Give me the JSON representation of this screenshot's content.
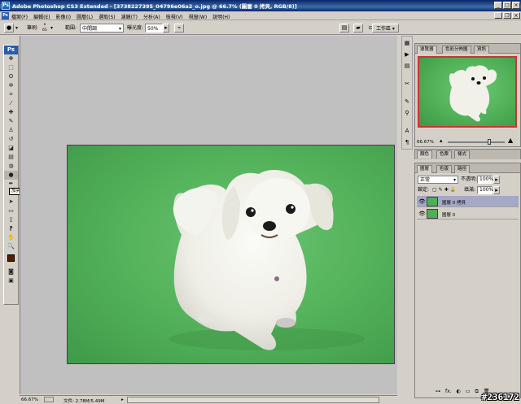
{
  "window": {
    "title": "Adobe Photoshop CS3 Extended - [3738227395_04796e06a2_o.jpg @ 66.7% (圖層 0 拷貝, RGB/8)]",
    "app_icon": "Ps"
  },
  "menu": {
    "items": [
      "檔案(F)",
      "編輯(E)",
      "影像(I)",
      "圖層(L)",
      "選取(S)",
      "濾鏡(T)",
      "分析(A)",
      "檢視(V)",
      "視窗(W)",
      "說明(H)"
    ]
  },
  "options": {
    "brush_label": "筆刷:",
    "brush_size": "65",
    "range_label": "範圍:",
    "range_value": "中間調",
    "exposure_label": "曝光度:",
    "exposure_value": "50%",
    "workspace_label": "工作區 ▾"
  },
  "toolbox": {
    "logo": "Ps",
    "tooltip": "加亮工具 (O)",
    "tools": [
      {
        "name": "move-tool-icon",
        "glyph": "✥"
      },
      {
        "name": "marquee-tool-icon",
        "glyph": "⬚"
      },
      {
        "name": "lasso-tool-icon",
        "glyph": "ʘ"
      },
      {
        "name": "magic-wand-icon",
        "glyph": "✲"
      },
      {
        "name": "crop-tool-icon",
        "glyph": "⌗"
      },
      {
        "name": "slice-tool-icon",
        "glyph": "⁄"
      },
      {
        "name": "healing-brush-icon",
        "glyph": "✚"
      },
      {
        "name": "brush-tool-icon",
        "glyph": "✎"
      },
      {
        "name": "clone-stamp-icon",
        "glyph": "♙"
      },
      {
        "name": "history-brush-icon",
        "glyph": "↺"
      },
      {
        "name": "eraser-tool-icon",
        "glyph": "◪"
      },
      {
        "name": "gradient-tool-icon",
        "glyph": "▤"
      },
      {
        "name": "blur-tool-icon",
        "glyph": "◍"
      },
      {
        "name": "dodge-tool-icon",
        "glyph": "●"
      },
      {
        "name": "pen-tool-icon",
        "glyph": "✒"
      },
      {
        "name": "type-tool-icon",
        "glyph": "T"
      },
      {
        "name": "path-selection-icon",
        "glyph": "➤"
      },
      {
        "name": "shape-tool-icon",
        "glyph": "▭"
      },
      {
        "name": "notes-tool-icon",
        "glyph": "▯"
      },
      {
        "name": "eyedropper-icon",
        "glyph": "⁋"
      },
      {
        "name": "hand-tool-icon",
        "glyph": "✋"
      },
      {
        "name": "zoom-tool-icon",
        "glyph": "🔍"
      }
    ],
    "foreground_color": "#5a1a08",
    "background_color": "#ffffff"
  },
  "status": {
    "zoom": "66.67%",
    "doc_size": "文件: 2.78M/5.49M"
  },
  "navigator": {
    "tabs": [
      "導覽器",
      "色彩分佈圖",
      "資訊"
    ],
    "zoom": "66.67%"
  },
  "color_panel": {
    "tabs": [
      "顏色",
      "色票",
      "樣式"
    ]
  },
  "layers_panel": {
    "tabs": [
      "圖層",
      "色版",
      "路徑"
    ],
    "blend_mode": "正常",
    "opacity_label": "不透明:",
    "opacity": "100%",
    "lock_label": "鎖定:",
    "fill_label": "填滿:",
    "fill": "100%",
    "layers": [
      {
        "name": "圖層 0 拷貝",
        "selected": true
      },
      {
        "name": "圖層 0",
        "selected": false
      }
    ],
    "bottom_icons": [
      "⊶",
      "fx.",
      "◐",
      "▭",
      "⧉",
      "🗑"
    ]
  },
  "watermark": "#236172"
}
